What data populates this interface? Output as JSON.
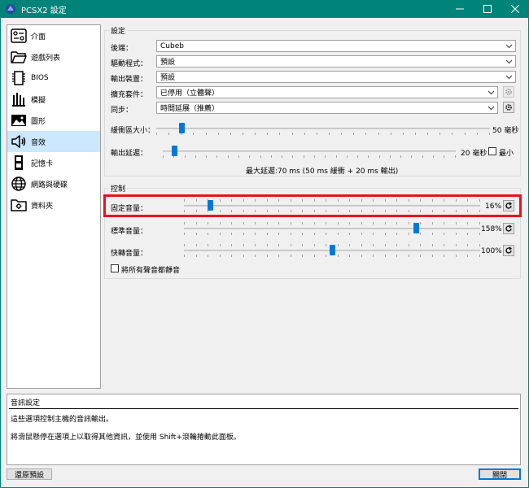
{
  "window": {
    "title": "PCSX2 設定",
    "accent": "#008378",
    "controls": [
      "minimize",
      "maximize",
      "close"
    ]
  },
  "sidebar": {
    "items": [
      {
        "label": "介面",
        "icon": "interface-icon",
        "active": false
      },
      {
        "label": "遊戲列表",
        "icon": "folder-open-icon",
        "active": false
      },
      {
        "label": "BIOS",
        "icon": "chip-icon",
        "active": false
      },
      {
        "label": "模擬",
        "icon": "emulation-icon",
        "active": false
      },
      {
        "label": "圖形",
        "icon": "image-icon",
        "active": false
      },
      {
        "label": "音效",
        "icon": "speaker-icon",
        "active": true
      },
      {
        "label": "記憶卡",
        "icon": "memory-card-icon",
        "active": false
      },
      {
        "label": "網路與硬碟",
        "icon": "globe-icon",
        "active": false
      },
      {
        "label": "資料夾",
        "icon": "folder-settings-icon",
        "active": false
      }
    ]
  },
  "settings": {
    "group_title": "設定",
    "backend": {
      "label": "後端：",
      "value": "Cubeb"
    },
    "driver": {
      "label": "驅動程式：",
      "value": "預設"
    },
    "output_device": {
      "label": "輸出裝置：",
      "value": "預設"
    },
    "expansion": {
      "label": "擴充套件：",
      "value": "已停用（立體聲）"
    },
    "sync": {
      "label": "同步：",
      "value": "時間延展（推薦）"
    },
    "buffer_size": {
      "label": "緩衝區大小：",
      "value_text": "50 毫秒",
      "fraction": 0.07
    },
    "output_latency": {
      "label": "輸出延遲：",
      "value_text": "20 毫秒",
      "fraction": 0.03,
      "minimal_label": "最小",
      "minimal_checked": false
    },
    "max_latency_text": "最大延遲:70 ms (50 ms 緩衝 + 20 ms 輸出)"
  },
  "control": {
    "group_title": "控制",
    "standard_volume": {
      "label": "固定音量：",
      "value_text": "16%",
      "fraction": 0.08
    },
    "normal_volume": {
      "label": "標準音量：",
      "value_text": "158%",
      "fraction": 0.79
    },
    "fast_forward_volume": {
      "label": "快轉音量：",
      "value_text": "100%",
      "fraction": 0.5
    },
    "mute_all": {
      "label": "將所有聲音都靜音",
      "checked": false
    }
  },
  "description": {
    "title": "音訊設定",
    "line1": "這些選項控制主機的音訊輸出。",
    "line2": "將滑鼠懸停在選項上以取得其他資訊，並使用 Shift+滾輪捲動此面板。"
  },
  "footer": {
    "restore_label": "還原預設",
    "close_label": "關閉"
  },
  "colors": {
    "slider_thumb": "#0078d7",
    "selected_item": "#cce8ff",
    "highlight": "#e8131b"
  }
}
